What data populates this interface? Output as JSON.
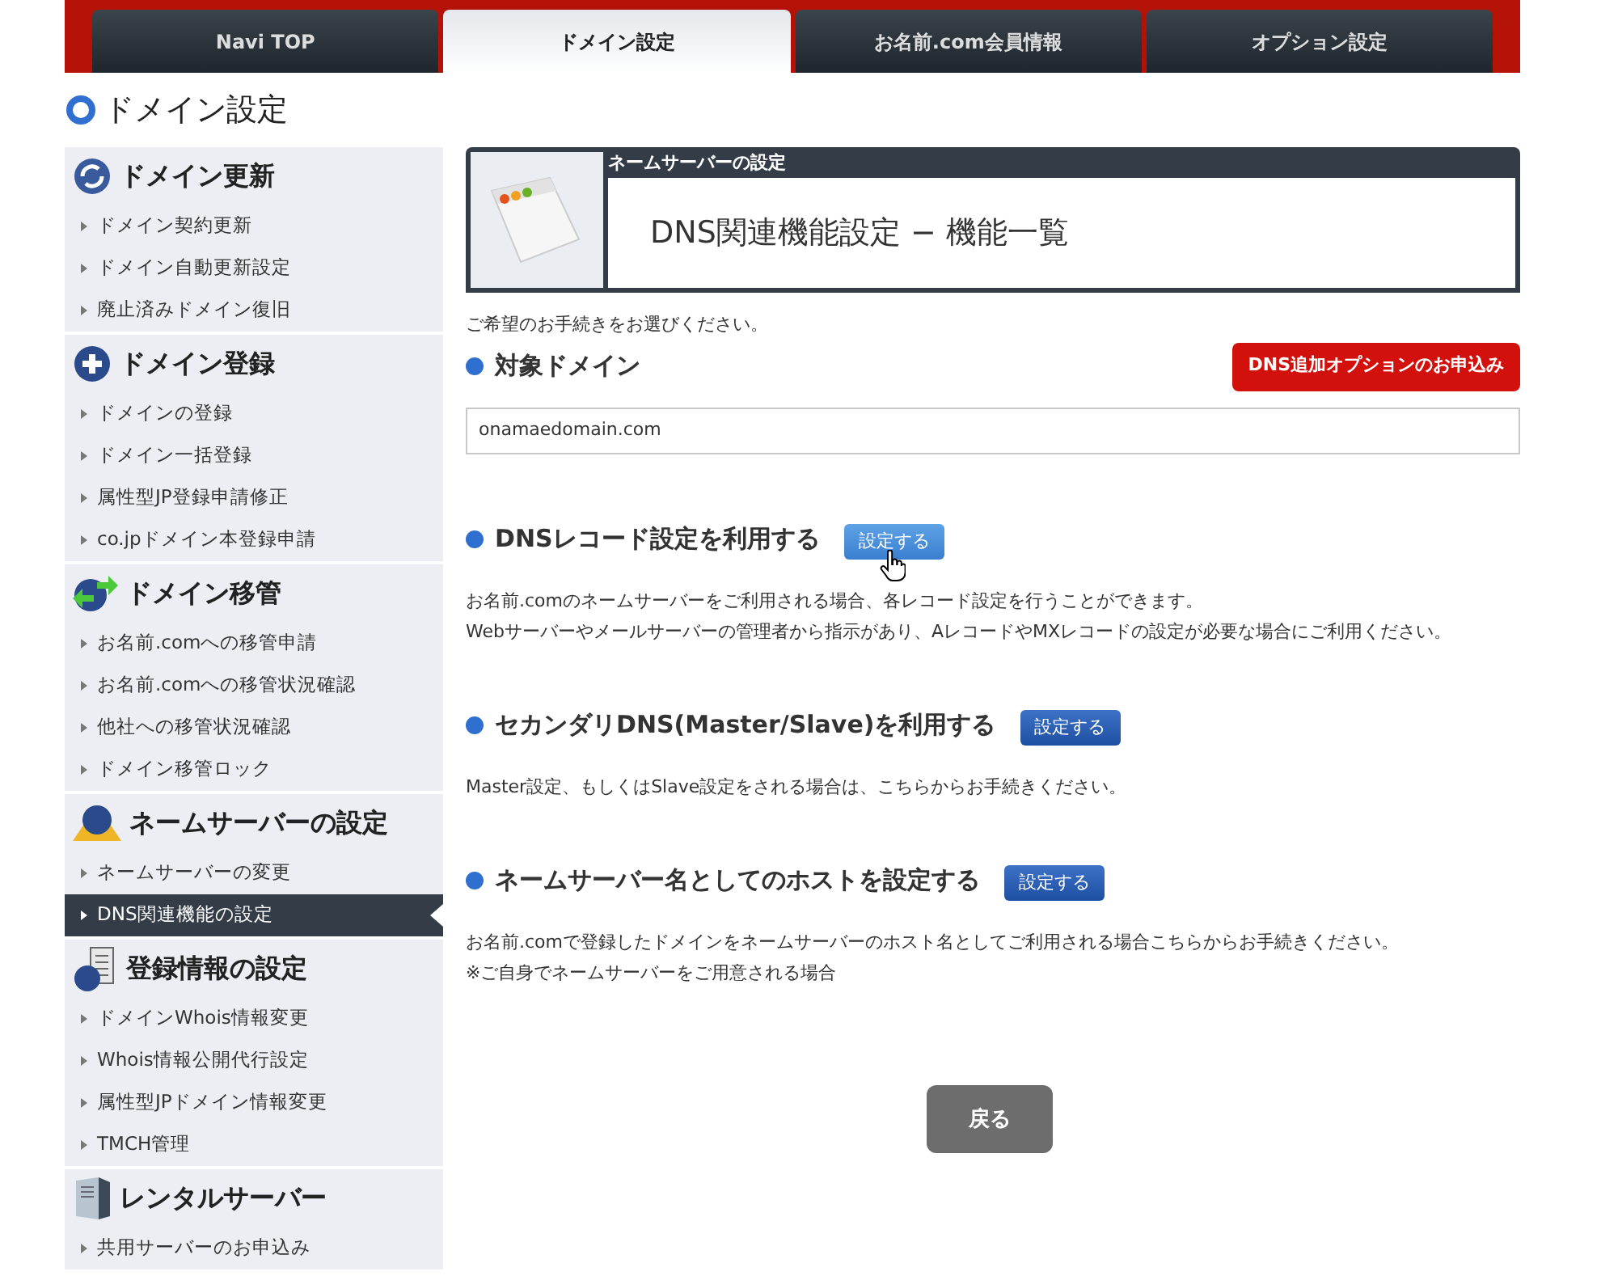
{
  "tabs": [
    {
      "label": "Navi TOP",
      "selected": false
    },
    {
      "label": "ドメイン設定",
      "selected": true
    },
    {
      "label": "お名前.com会員情報",
      "selected": false
    },
    {
      "label": "オプション設定",
      "selected": false
    }
  ],
  "page_title": "ドメイン設定",
  "sidebar": [
    {
      "kind": "renew",
      "title": "ドメイン更新",
      "items": [
        {
          "label": "ドメイン契約更新",
          "selected": false
        },
        {
          "label": "ドメイン自動更新設定",
          "selected": false
        },
        {
          "label": "廃止済みドメイン復旧",
          "selected": false
        }
      ]
    },
    {
      "kind": "register",
      "title": "ドメイン登録",
      "items": [
        {
          "label": "ドメインの登録",
          "selected": false
        },
        {
          "label": "ドメイン一括登録",
          "selected": false
        },
        {
          "label": "属性型JP登録申請修正",
          "selected": false
        },
        {
          "label": "co.jpドメイン本登録申請",
          "selected": false
        }
      ]
    },
    {
      "kind": "transfer",
      "title": "ドメイン移管",
      "items": [
        {
          "label": "お名前.comへの移管申請",
          "selected": false
        },
        {
          "label": "お名前.comへの移管状況確認",
          "selected": false
        },
        {
          "label": "他社への移管状況確認",
          "selected": false
        },
        {
          "label": "ドメイン移管ロック",
          "selected": false
        }
      ]
    },
    {
      "kind": "nameserver",
      "title": "ネームサーバーの設定",
      "items": [
        {
          "label": "ネームサーバーの変更",
          "selected": false
        },
        {
          "label": "DNS関連機能の設定",
          "selected": true
        }
      ]
    },
    {
      "kind": "info",
      "title": "登録情報の設定",
      "items": [
        {
          "label": "ドメインWhois情報変更",
          "selected": false
        },
        {
          "label": "Whois情報公開代行設定",
          "selected": false
        },
        {
          "label": "属性型JPドメイン情報変更",
          "selected": false
        },
        {
          "label": "TMCH管理",
          "selected": false
        }
      ]
    },
    {
      "kind": "server",
      "title": "レンタルサーバー",
      "items": [
        {
          "label": "共用サーバーのお申込み",
          "selected": false
        }
      ]
    }
  ],
  "header": {
    "category": "ネームサーバーの設定",
    "title": "DNS関連機能設定 − 機能一覧"
  },
  "intro": "ご希望のお手続きをお選びください。",
  "target": {
    "label": "対象ドメイン",
    "value": "onamaedomain.com",
    "option_button": "DNS追加オプションのお申込み"
  },
  "sections": [
    {
      "title": "DNSレコード設定を利用する",
      "button": "設定する",
      "hovered": true,
      "lines": [
        "お名前.comのネームサーバーをご利用される場合、各レコード設定を行うことができます。",
        "Webサーバーやメールサーバーの管理者から指示があり、AレコードやMXレコードの設定が必要な場合にご利用ください。"
      ]
    },
    {
      "title": "セカンダリDNS(Master/Slave)を利用する",
      "button": "設定する",
      "hovered": false,
      "lines": [
        "Master設定、もしくはSlave設定をされる場合は、こちらからお手続きください。"
      ]
    },
    {
      "title": "ネームサーバー名としてのホストを設定する",
      "button": "設定する",
      "hovered": false,
      "lines": [
        "お名前.comで登録したドメインをネームサーバーのホスト名としてご利用される場合こちらからお手続きください。",
        "※ご自身でネームサーバーをご用意される場合"
      ]
    }
  ],
  "back_button": "戻る"
}
